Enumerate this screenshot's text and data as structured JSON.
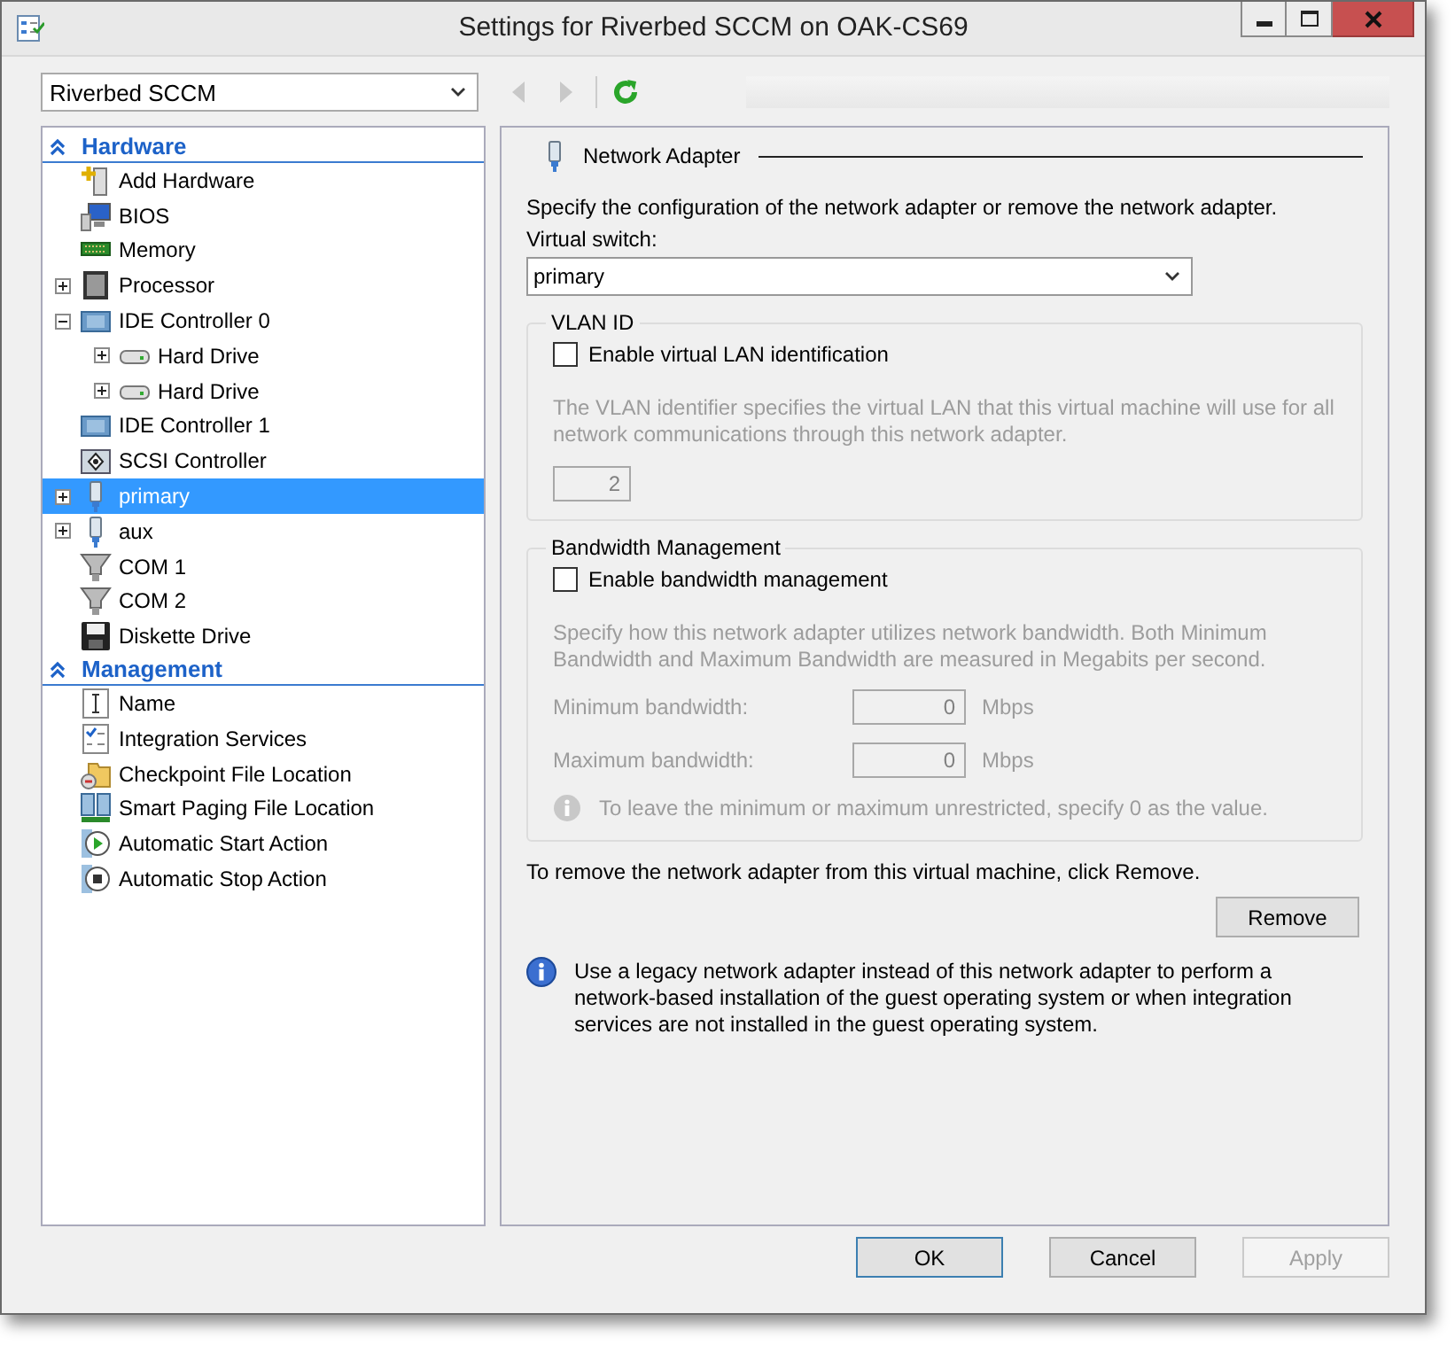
{
  "window": {
    "title": "Settings for Riverbed SCCM on OAK-CS69"
  },
  "vm_selector": {
    "value": "Riverbed SCCM"
  },
  "sidebar": {
    "sections": [
      {
        "title": "Hardware",
        "expanded": true,
        "items": [
          {
            "label": "Add Hardware",
            "selected": false
          },
          {
            "label": "BIOS",
            "selected": false
          },
          {
            "label": "Memory",
            "selected": false
          },
          {
            "label": "Processor",
            "selected": false,
            "expanded": false
          },
          {
            "label": "IDE Controller 0",
            "selected": false,
            "expanded": true,
            "children": [
              {
                "label": "Hard Drive",
                "selected": false,
                "expanded": false
              },
              {
                "label": "Hard Drive",
                "selected": false,
                "expanded": false
              }
            ]
          },
          {
            "label": "IDE Controller 1",
            "selected": false
          },
          {
            "label": "SCSI Controller",
            "selected": false
          },
          {
            "label": "primary",
            "selected": true,
            "expanded": false
          },
          {
            "label": "aux",
            "selected": false,
            "expanded": false
          },
          {
            "label": "COM 1",
            "selected": false
          },
          {
            "label": "COM 2",
            "selected": false
          },
          {
            "label": "Diskette Drive",
            "selected": false
          }
        ]
      },
      {
        "title": "Management",
        "expanded": true,
        "items": [
          {
            "label": "Name",
            "selected": false
          },
          {
            "label": "Integration Services",
            "selected": false
          },
          {
            "label": "Checkpoint File Location",
            "selected": false
          },
          {
            "label": "Smart Paging File Location",
            "selected": false
          },
          {
            "label": "Automatic Start Action",
            "selected": false
          },
          {
            "label": "Automatic Stop Action",
            "selected": false
          }
        ]
      }
    ]
  },
  "panel": {
    "title": "Network Adapter",
    "intro": "Specify the configuration of the network adapter or remove the network adapter.",
    "virtual_switch": {
      "label": "Virtual switch:",
      "value": "primary"
    },
    "vlan": {
      "title": "VLAN ID",
      "checkbox": {
        "label": "Enable virtual LAN identification",
        "checked": false
      },
      "disabled": true,
      "description": "The VLAN identifier specifies the virtual LAN that this virtual machine will use for all network communications through this network adapter.",
      "value": "2"
    },
    "bandwidth": {
      "title": "Bandwidth Management",
      "checkbox": {
        "label": "Enable bandwidth management",
        "checked": false
      },
      "disabled": true,
      "description": "Specify how this network adapter utilizes network bandwidth. Both Minimum Bandwidth and Maximum Bandwidth are measured in Megabits per second.",
      "fields": [
        {
          "label": "Minimum bandwidth:",
          "value": "0",
          "unit": "Mbps"
        },
        {
          "label": "Maximum bandwidth:",
          "value": "0",
          "unit": "Mbps"
        }
      ],
      "note": "To leave the minimum or maximum unrestricted, specify 0 as the value."
    },
    "remove_text": "To remove the network adapter from this virtual machine, click Remove.",
    "remove_button": "Remove",
    "info": "Use a legacy network adapter instead of this network adapter to perform a network-based installation of the guest operating system or when integration services are not installed in the guest operating system."
  },
  "buttons": [
    {
      "label": "OK",
      "disabled": false,
      "default": true
    },
    {
      "label": "Cancel",
      "disabled": false,
      "default": false
    },
    {
      "label": "Apply",
      "disabled": true,
      "default": false
    }
  ]
}
